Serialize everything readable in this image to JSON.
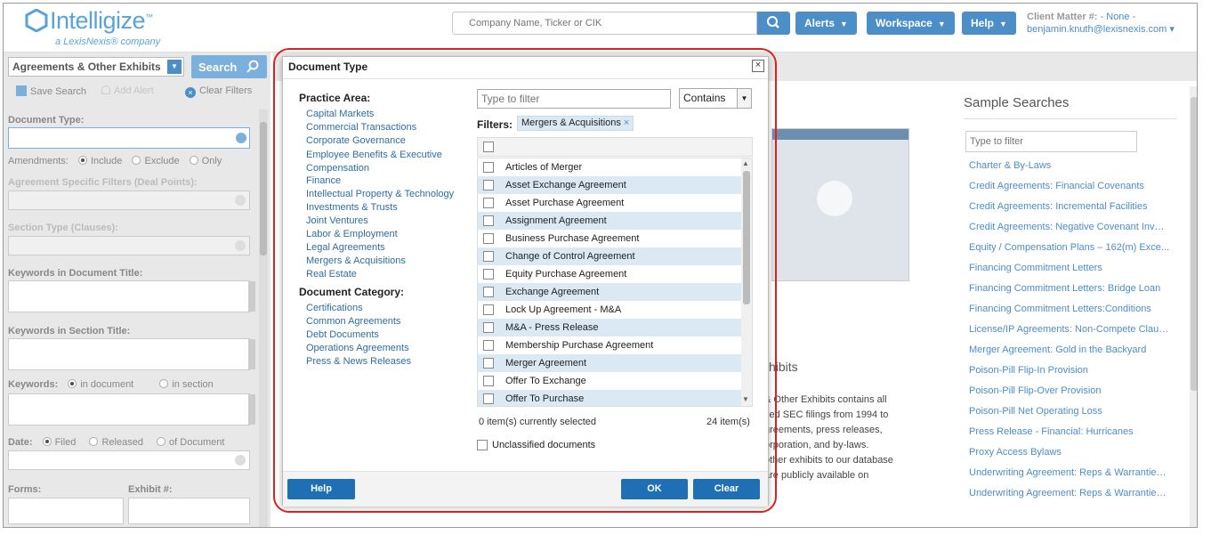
{
  "header": {
    "logo_text": "Intelligize",
    "logo_tm": "™",
    "logo_sub": "a LexisNexis® company",
    "search_placeholder": "Company Name, Ticker or CIK",
    "nav": [
      "Alerts",
      "Workspace",
      "Help"
    ],
    "client_matter_label": "Client Matter #:",
    "client_matter_value": "- None -",
    "user": "benjamin.knuth@lexisnexis.com"
  },
  "left_panel": {
    "doc_type_select": "Agreements & Other Exhibits",
    "search_button": "Search",
    "actions": {
      "save": "Save Search",
      "alert": "Add Alert",
      "clear": "Clear Filters"
    },
    "document_type_label": "Document Type:",
    "amendments_label": "Amendments:",
    "amendments_options": [
      "Include",
      "Exclude",
      "Only"
    ],
    "agreement_filters_label": "Agreement Specific Filters (Deal Points):",
    "section_type_label": "Section Type (Clauses):",
    "keywords_doc_title_label": "Keywords in Document Title:",
    "keywords_section_title_label": "Keywords in Section Title:",
    "keywords_label": "Keywords:",
    "keywords_options": [
      "in document",
      "in section"
    ],
    "date_label": "Date:",
    "date_options": [
      "Filed",
      "Released",
      "of Document"
    ],
    "forms_label": "Forms:",
    "exhibit_label": "Exhibit #:"
  },
  "main": {
    "partial_heading": "xhibits",
    "partial_text": [
      "& Other Exhibits contains all",
      "sed SEC filings from 1994 to",
      "greements, press releases,",
      "orporation, and by-laws.",
      "other exhibits to our database",
      "are publicly available on"
    ],
    "samples_title": "Sample Searches",
    "samples_filter_placeholder": "Type to filter",
    "samples": [
      "Charter & By-Laws",
      "Credit Agreements: Financial Covenants",
      "Credit Agreements: Incremental Facilities",
      "Credit Agreements: Negative Covenant Inves...",
      "Equity / Compensation Plans – 162(m) Exce...",
      "Financing Commitment Letters",
      "Financing Commitment Letters: Bridge Loan",
      "Financing Commitment Letters:Conditions",
      "License/IP Agreements: Non-Compete Clauses",
      "Merger Agreement: Gold in the Backyard",
      "Poison-Pill Flip-In Provision",
      "Poison-Pill Flip-Over Provision",
      "Poison-Pill Net Operating Loss",
      "Press Release - Financial: Hurricanes",
      "Proxy Access Bylaws",
      "Underwriting Agreement: Reps & Warranties...",
      "Underwriting Agreement: Reps & Warranties..."
    ]
  },
  "dialog": {
    "title": "Document Type",
    "close": "×",
    "practice_area_title": "Practice Area:",
    "practice_areas": [
      "Capital Markets",
      "Commercial Transactions",
      "Corporate Governance",
      "Employee Benefits & Executive Compensation",
      "Finance",
      "Intellectual Property & Technology",
      "Investments & Trusts",
      "Joint Ventures",
      "Labor & Employment",
      "Legal Agreements",
      "Mergers & Acquisitions",
      "Real Estate"
    ],
    "document_category_title": "Document Category:",
    "document_categories": [
      "Certifications",
      "Common Agreements",
      "Debt Documents",
      "Operations Agreements",
      "Press & News Releases"
    ],
    "filter_placeholder": "Type to filter",
    "match_mode": "Contains",
    "filters_label": "Filters:",
    "active_filter": "Mergers & Acquisitions",
    "chip_remove": "×",
    "items": [
      "Articles of Merger",
      "Asset Exchange Agreement",
      "Asset Purchase Agreement",
      "Assignment Agreement",
      "Business Purchase Agreement",
      "Change of Control Agreement",
      "Equity Purchase Agreement",
      "Exchange Agreement",
      "Lock Up Agreement - M&A",
      "M&A - Press Release",
      "Membership Purchase Agreement",
      "Merger Agreement",
      "Offer To Exchange",
      "Offer To Purchase"
    ],
    "selected_text": "0 item(s) currently selected",
    "total_text": "24 item(s)",
    "unclassified_label": "Unclassified documents",
    "help_button": "Help",
    "ok_button": "OK",
    "clear_button": "Clear"
  },
  "colors": {
    "accent": "#4b8ec8",
    "button": "#1f6fb5",
    "highlight": "#dbe9f5",
    "annotation": "#e02020"
  }
}
